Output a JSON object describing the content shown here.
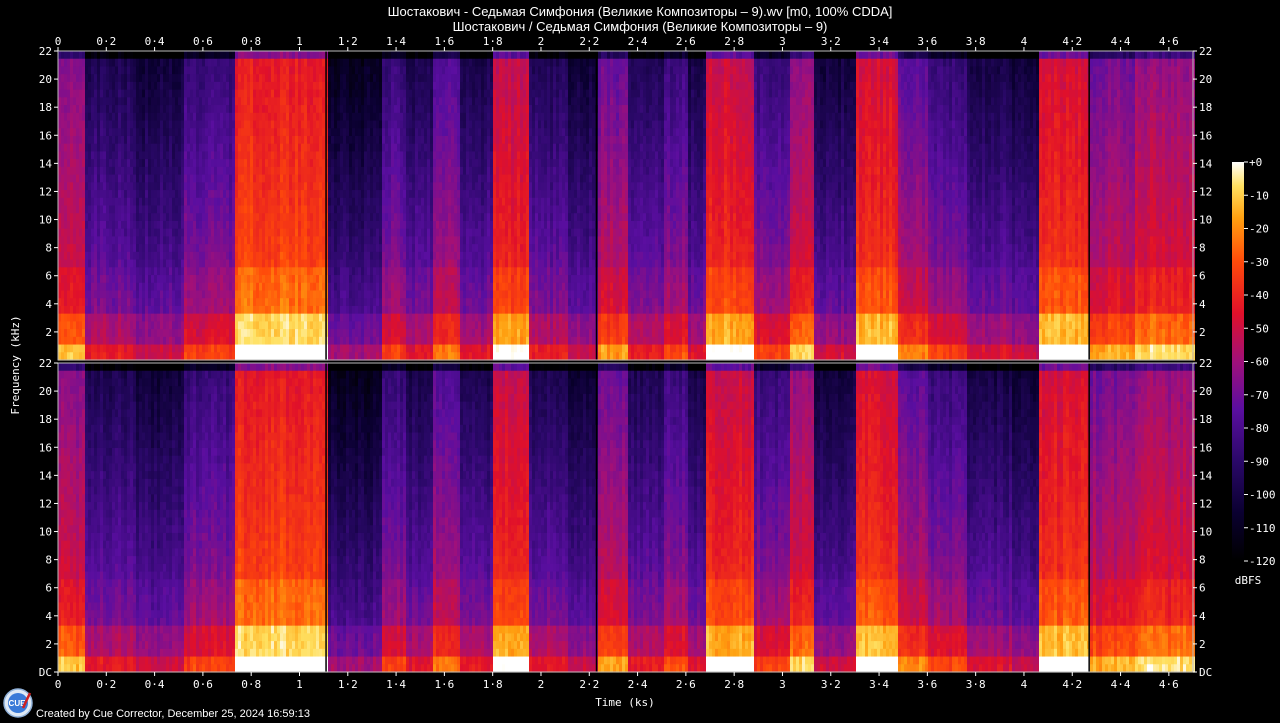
{
  "header": {
    "title_line1": "Шостакович - Седьмая Симфония (Великие Композиторы – 9).wv [m0, 100% CDDA]",
    "title_line2": "Шостакович / Седьмая Симфония (Великие Композиторы – 9)"
  },
  "footer": {
    "credit": "Created by Cue Corrector, December 25, 2024 16:59:13",
    "logo_text": "CUE"
  },
  "chart_data": {
    "type": "heatmap",
    "xlabel": "Time (ks)",
    "ylabel": "Frequency (kHz)",
    "xlim": [
      0,
      4.7
    ],
    "ylim": [
      0,
      22
    ],
    "x_ticks": [
      "0",
      "0·2",
      "0·4",
      "0·6",
      "0·8",
      "1",
      "1·2",
      "1·4",
      "1·6",
      "1·8",
      "2",
      "2·2",
      "2·4",
      "2·6",
      "2·8",
      "3",
      "3·2",
      "3·4",
      "3·6",
      "3·8",
      "4",
      "4·2",
      "4·4",
      "4·6"
    ],
    "x_tick_values": [
      0,
      0.2,
      0.4,
      0.6,
      0.8,
      1.0,
      1.2,
      1.4,
      1.6,
      1.8,
      2.0,
      2.2,
      2.4,
      2.6,
      2.8,
      3.0,
      3.2,
      3.4,
      3.6,
      3.8,
      4.0,
      4.2,
      4.4,
      4.6
    ],
    "y_ticks_top": [
      "2",
      "4",
      "6",
      "8",
      "10",
      "12",
      "14",
      "16",
      "18",
      "20",
      "22"
    ],
    "y_ticks_bottom": [
      "DC",
      "2",
      "4",
      "6",
      "8",
      "10",
      "12",
      "14",
      "16",
      "18",
      "20",
      "22"
    ],
    "y_tick_values_top": [
      2,
      4,
      6,
      8,
      10,
      12,
      14,
      16,
      18,
      20,
      22
    ],
    "y_tick_values_bottom": [
      0,
      2,
      4,
      6,
      8,
      10,
      12,
      14,
      16,
      18,
      20,
      22
    ],
    "channels": 2,
    "colorbar": {
      "label": "dBFS",
      "range": [
        -120,
        0
      ],
      "ticks": [
        "+0",
        "-10",
        "-20",
        "-30",
        "-40",
        "-50",
        "-60",
        "-70",
        "-80",
        "-90",
        "-100",
        "-110",
        "-120"
      ],
      "tick_values": [
        0,
        -10,
        -20,
        -30,
        -40,
        -50,
        -60,
        -70,
        -80,
        -90,
        -100,
        -110,
        -120
      ]
    },
    "track_boundaries": [
      1.11,
      2.23,
      4.27
    ],
    "energy_segments": [
      {
        "x": [
          0.0,
          0.1
        ],
        "level": 0.62
      },
      {
        "x": [
          0.1,
          0.32
        ],
        "level": 0.3
      },
      {
        "x": [
          0.32,
          0.52
        ],
        "level": 0.22
      },
      {
        "x": [
          0.52,
          0.73
        ],
        "level": 0.4
      },
      {
        "x": [
          0.73,
          1.11
        ],
        "level": 0.86
      },
      {
        "x": [
          1.11,
          1.33
        ],
        "level": 0.14
      },
      {
        "x": [
          1.33,
          1.43
        ],
        "level": 0.4
      },
      {
        "x": [
          1.43,
          1.55
        ],
        "level": 0.28
      },
      {
        "x": [
          1.55,
          1.66
        ],
        "level": 0.5
      },
      {
        "x": [
          1.66,
          1.8
        ],
        "level": 0.28
      },
      {
        "x": [
          1.8,
          1.95
        ],
        "level": 0.76
      },
      {
        "x": [
          1.95,
          2.1
        ],
        "level": 0.3
      },
      {
        "x": [
          2.1,
          2.23
        ],
        "level": 0.22
      },
      {
        "x": [
          2.23,
          2.36
        ],
        "level": 0.55
      },
      {
        "x": [
          2.36,
          2.5
        ],
        "level": 0.3
      },
      {
        "x": [
          2.5,
          2.6
        ],
        "level": 0.42
      },
      {
        "x": [
          2.6,
          2.68
        ],
        "level": 0.26
      },
      {
        "x": [
          2.68,
          2.88
        ],
        "level": 0.78
      },
      {
        "x": [
          2.88,
          3.02
        ],
        "level": 0.4
      },
      {
        "x": [
          3.02,
          3.12
        ],
        "level": 0.65
      },
      {
        "x": [
          3.12,
          3.3
        ],
        "level": 0.24
      },
      {
        "x": [
          3.3,
          3.47
        ],
        "level": 0.8
      },
      {
        "x": [
          3.47,
          3.6
        ],
        "level": 0.52
      },
      {
        "x": [
          3.6,
          3.76
        ],
        "level": 0.4
      },
      {
        "x": [
          3.76,
          3.95
        ],
        "level": 0.26
      },
      {
        "x": [
          3.95,
          4.05
        ],
        "level": 0.22
      },
      {
        "x": [
          4.05,
          4.27
        ],
        "level": 0.8
      },
      {
        "x": [
          4.27,
          4.45
        ],
        "level": 0.58
      },
      {
        "x": [
          4.45,
          4.7
        ],
        "level": 0.66
      }
    ]
  }
}
